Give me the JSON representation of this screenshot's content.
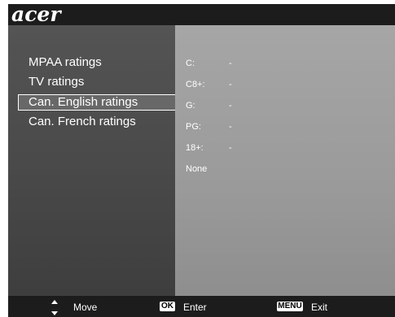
{
  "header": {
    "logo": "acer"
  },
  "menu": {
    "items": [
      {
        "label": "MPAA ratings"
      },
      {
        "label": "TV ratings"
      },
      {
        "label": "Can. English ratings"
      },
      {
        "label": "Can. French ratings"
      }
    ],
    "selected_index": 2
  },
  "ratings": [
    {
      "key": "C:",
      "value": "-"
    },
    {
      "key": "C8+:",
      "value": "-"
    },
    {
      "key": "G:",
      "value": "-"
    },
    {
      "key": "PG:",
      "value": "-"
    },
    {
      "key": "18+:",
      "value": "-"
    },
    {
      "key": "None",
      "value": ""
    }
  ],
  "footer": {
    "move_label": "Move",
    "ok_badge": "OK",
    "enter_label": "Enter",
    "menu_badge": "MENU",
    "exit_label": "Exit"
  },
  "colors": {
    "background": "#1c1c1c",
    "left_panel": "#4a4a4a",
    "right_panel": "#9a9a9a",
    "text": "#ffffff"
  }
}
